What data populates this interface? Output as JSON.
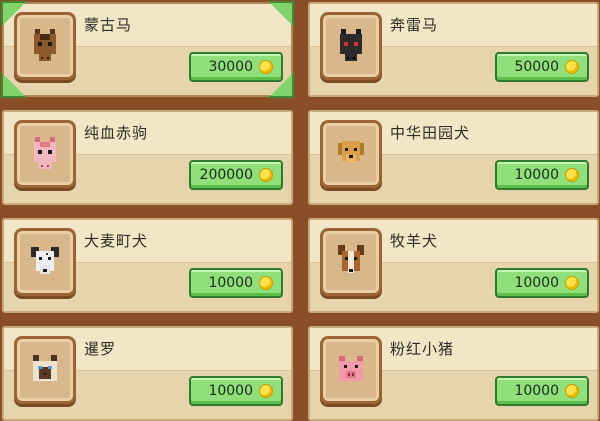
{
  "colors": {
    "wood_background": "#8a4f26",
    "card_fill": "#f1e6c6",
    "price_button": "#8fe07a",
    "selection_corner": "#7fd46a",
    "coin": "#ffe14a"
  },
  "shop": {
    "items": [
      {
        "name": "蒙古马",
        "price": "30000",
        "icon": "brown-horse-icon",
        "selected": true
      },
      {
        "name": "奔雷马",
        "price": "50000",
        "icon": "black-horse-icon",
        "selected": false
      },
      {
        "name": "纯血赤驹",
        "price": "200000",
        "icon": "pink-horse-icon",
        "selected": false
      },
      {
        "name": "中华田园犬",
        "price": "10000",
        "icon": "yellow-dog-icon",
        "selected": false
      },
      {
        "name": "大麦町犬",
        "price": "10000",
        "icon": "dalmatian-dog-icon",
        "selected": false
      },
      {
        "name": "牧羊犬",
        "price": "10000",
        "icon": "shepherd-dog-icon",
        "selected": false
      },
      {
        "name": "暹罗",
        "price": "10000",
        "icon": "siamese-cat-icon",
        "selected": false
      },
      {
        "name": "粉红小猪",
        "price": "10000",
        "icon": "pink-pig-icon",
        "selected": false
      }
    ]
  }
}
